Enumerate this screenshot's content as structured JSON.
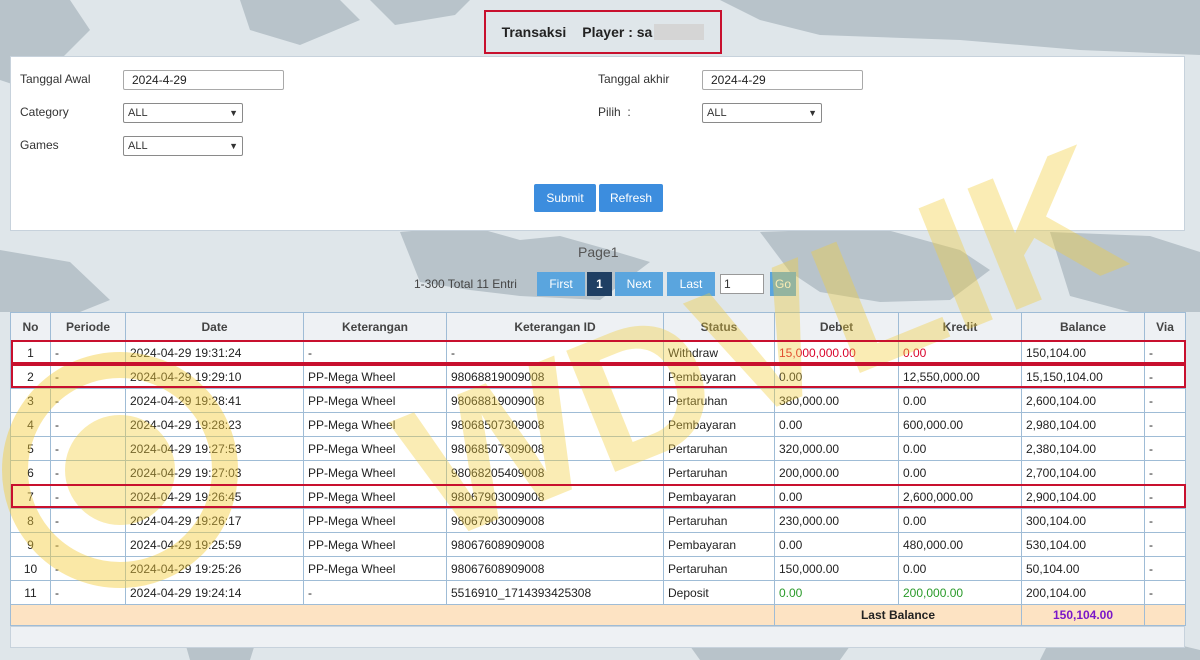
{
  "header": {
    "section": "Transaksi",
    "player_label": "Player : sa"
  },
  "filters": {
    "tanggal_awal_label": "Tanggal Awal",
    "tanggal_awal_value": "2024-4-29",
    "tanggal_akhir_label": "Tanggal akhir",
    "tanggal_akhir_value": "2024-4-29",
    "category_label": "Category",
    "category_value": "ALL",
    "pilih_label": "Pilih  :",
    "pilih_value": "ALL",
    "games_label": "Games",
    "games_value": "ALL",
    "submit_label": "Submit",
    "refresh_label": "Refresh"
  },
  "pagination": {
    "page_label": "Page1",
    "total_label": "1-300 Total 11 Entri",
    "first_label": "First",
    "current_page": "1",
    "next_label": "Next",
    "last_label": "Last",
    "page_input_value": "1",
    "go_label": "Go"
  },
  "table": {
    "headers": [
      "No",
      "Periode",
      "Date",
      "Keterangan",
      "Keterangan ID",
      "Status",
      "Debet",
      "Kredit",
      "Balance",
      "Via"
    ],
    "rows": [
      [
        "1",
        "-",
        "2024-04-29 19:31:24",
        "-",
        "-",
        "Withdraw",
        "15,000,000.00",
        "0.00",
        "150,104.00",
        "-"
      ],
      [
        "2",
        "-",
        "2024-04-29 19:29:10",
        "PP-Mega Wheel",
        "98068819009008",
        "Pembayaran",
        "0.00",
        "12,550,000.00",
        "15,150,104.00",
        "-"
      ],
      [
        "3",
        "-",
        "2024-04-29 19:28:41",
        "PP-Mega Wheel",
        "98068819009008",
        "Pertaruhan",
        "380,000.00",
        "0.00",
        "2,600,104.00",
        "-"
      ],
      [
        "4",
        "-",
        "2024-04-29 19:28:23",
        "PP-Mega Wheel",
        "98068507309008",
        "Pembayaran",
        "0.00",
        "600,000.00",
        "2,980,104.00",
        "-"
      ],
      [
        "5",
        "-",
        "2024-04-29 19:27:53",
        "PP-Mega Wheel",
        "98068507309008",
        "Pertaruhan",
        "320,000.00",
        "0.00",
        "2,380,104.00",
        "-"
      ],
      [
        "6",
        "-",
        "2024-04-29 19:27:03",
        "PP-Mega Wheel",
        "98068205409008",
        "Pertaruhan",
        "200,000.00",
        "0.00",
        "2,700,104.00",
        "-"
      ],
      [
        "7",
        "-",
        "2024-04-29 19:26:45",
        "PP-Mega Wheel",
        "98067903009008",
        "Pembayaran",
        "0.00",
        "2,600,000.00",
        "2,900,104.00",
        "-"
      ],
      [
        "8",
        "-",
        "2024-04-29 19:26:17",
        "PP-Mega Wheel",
        "98067903009008",
        "Pertaruhan",
        "230,000.00",
        "0.00",
        "300,104.00",
        "-"
      ],
      [
        "9",
        "-",
        "2024-04-29 19:25:59",
        "PP-Mega Wheel",
        "98067608909008",
        "Pembayaran",
        "0.00",
        "480,000.00",
        "530,104.00",
        "-"
      ],
      [
        "10",
        "-",
        "2024-04-29 19:25:26",
        "PP-Mega Wheel",
        "98067608909008",
        "Pertaruhan",
        "150,000.00",
        "0.00",
        "50,104.00",
        "-"
      ],
      [
        "11",
        "-",
        "2024-04-29 19:24:14",
        "-",
        "5516910_1714393425308",
        "Deposit",
        "0.00",
        "200,000.00",
        "200,104.00",
        "-"
      ]
    ],
    "footer_label": "Last Balance",
    "footer_value": "150,104.00"
  },
  "colors": {
    "button_blue": "#3c8dde",
    "active_page": "#1f3f63",
    "highlight_red": "#c8102e",
    "footer_bg": "#fde3c3",
    "last_balance_purple": "#7a16c9"
  },
  "watermark_text": "WDVLIK"
}
